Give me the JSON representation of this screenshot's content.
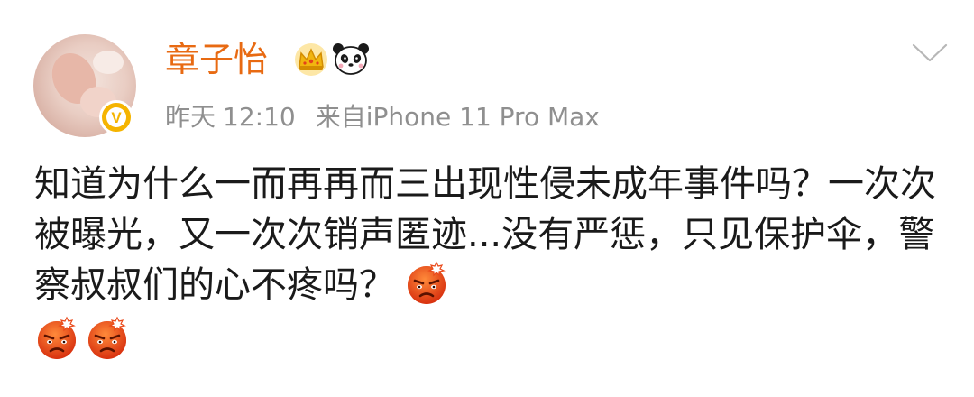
{
  "post": {
    "author": "章子怡",
    "date": "昨天",
    "time": "12:10",
    "source": "来自iPhone 11 Pro Max",
    "text": "知道为什么一而再再而三出现性侵未成年事件吗？一次次被曝光，又一次次销声匿迹...没有严惩，只见保护伞，警察叔叔们的心不疼吗？",
    "emojis": [
      "angry-face-icon",
      "angry-face-icon",
      "angry-face-icon"
    ],
    "badges": [
      "crown-icon",
      "panda-icon"
    ],
    "verify_mark": "V"
  },
  "colors": {
    "username": "#e86a12",
    "meta": "#8f8f8f",
    "text": "#1a1a1a",
    "verify": "#f5b400",
    "emoji_face": "#ea4a1b"
  }
}
